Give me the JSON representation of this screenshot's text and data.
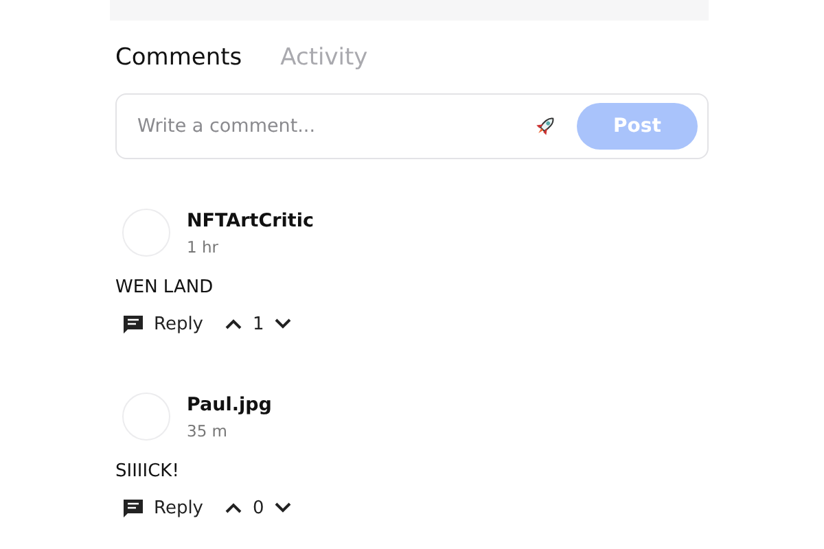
{
  "tabs": [
    {
      "label": "Comments",
      "selected": true
    },
    {
      "label": "Activity",
      "selected": false
    }
  ],
  "composer": {
    "placeholder": "Write a comment...",
    "post_label": "Post",
    "disabled": true
  },
  "comments": [
    {
      "author": "NFTArtCritic",
      "time": "1 hr",
      "text": "WEN LAND",
      "reply_label": "Reply",
      "votes": "1"
    },
    {
      "author": "Paul.jpg",
      "time": "35 m",
      "text": "SIIIICK!",
      "reply_label": "Reply",
      "votes": "0"
    }
  ]
}
